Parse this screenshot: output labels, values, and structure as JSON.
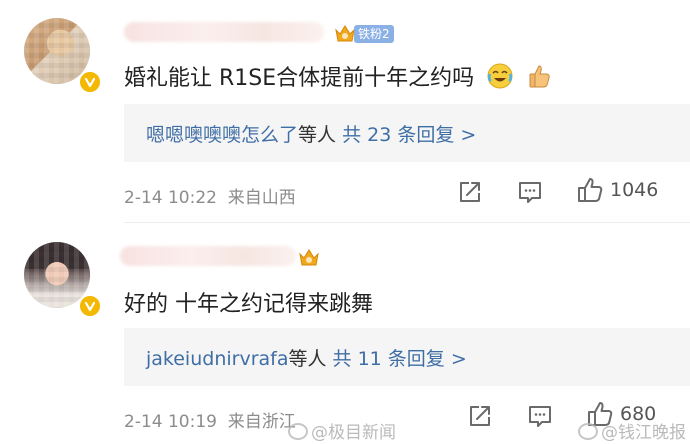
{
  "comments": [
    {
      "fan_badge": "铁粉2",
      "text": "婚礼能让 R1SE合体提前十年之约吗",
      "emoji": [
        "laughing-crying-emoji",
        "thumbs-up-emoji"
      ],
      "replies": {
        "names": "嗯嗯噢噢噢怎么了",
        "mid": "等人",
        "count_link": "共 23 条回复 >"
      },
      "time": "2-14 10:22",
      "location": "来自山西",
      "likes": "1046"
    },
    {
      "text": "好的 十年之约记得来跳舞",
      "replies": {
        "names": "jakeiudnirvrafa",
        "mid": "等人",
        "count_link": "共 11 条回复 >"
      },
      "time": "2-14 10:19",
      "location": "来自浙江",
      "likes": "680"
    }
  ],
  "watermarks": [
    "@极目新闻",
    "@钱江晚报"
  ],
  "colors": {
    "link": "#3f6ea5",
    "reply_bg": "#f5f5f5",
    "vip": "#f5b800",
    "fan_badge": "#8ab0e6"
  }
}
